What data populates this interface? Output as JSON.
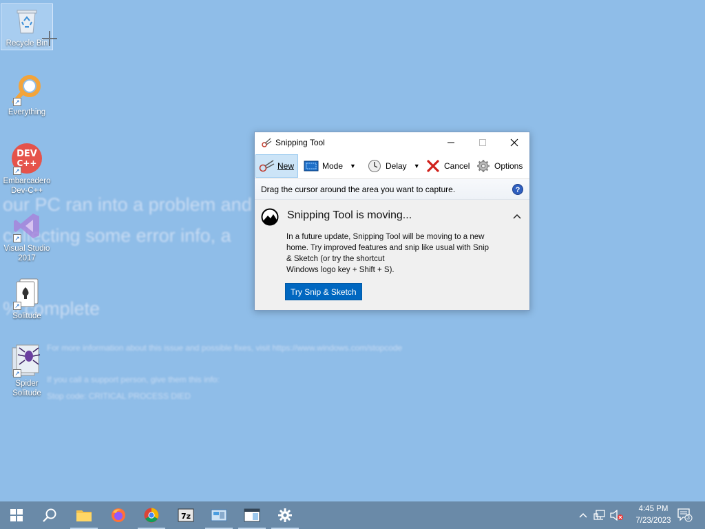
{
  "desktop": {
    "icons": [
      {
        "label": "Recycle Bin"
      },
      {
        "label": "Everything"
      },
      {
        "label": "Embarcadero Dev-C++"
      },
      {
        "label": "Visual Studio 2017"
      },
      {
        "label": "Solitude"
      },
      {
        "label": "Spider Solitude"
      }
    ],
    "background_ghost": {
      "line1": "our PC ran into a problem and",
      "line2": "collecting some error info, a",
      "line3": "% complete",
      "small1": "For more information about this issue and possible fixes, visit https://www.windows.com/stopcode",
      "small2": "If you call a support person, give them this info:",
      "small3": "Stop code: CRITICAL PROCESS DIED"
    }
  },
  "snipping_tool": {
    "title": "Snipping Tool",
    "toolbar": {
      "new_label": "New",
      "mode_label": "Mode",
      "delay_label": "Delay",
      "cancel_label": "Cancel",
      "options_label": "Options"
    },
    "instruction": "Drag the cursor around the area you want to capture.",
    "notice": {
      "title": "Snipping Tool is moving...",
      "body_line1": "In a future update, Snipping Tool will be moving to a new",
      "body_line2": "home. Try improved features and snip like usual with Snip",
      "body_line3": "& Sketch (or try the shortcut",
      "body_line4": "Windows logo key + Shift + S).",
      "button": "Try Snip & Sketch"
    }
  },
  "taskbar": {
    "clock_time": "4:45 PM",
    "clock_date": "7/23/2023",
    "notification_count": "3"
  },
  "colors": {
    "desktop_bg": "#8fbde8",
    "taskbar_bg": "#6a8aa8",
    "accent": "#0067c0"
  }
}
